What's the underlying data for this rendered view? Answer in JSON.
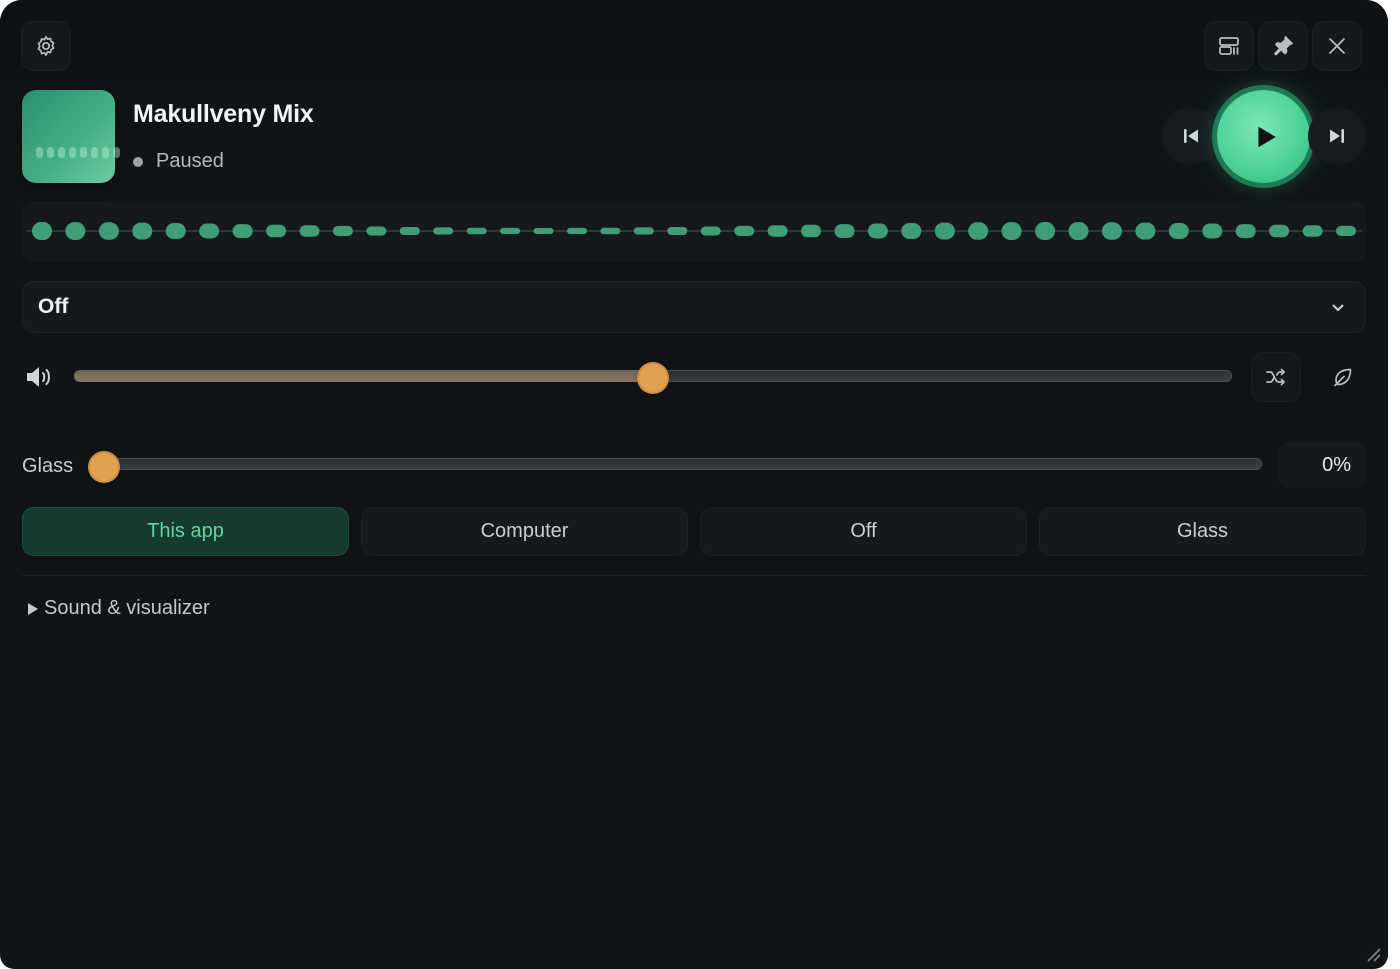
{
  "titlebar": {
    "icons": [
      "gear-icon",
      "layout-icon",
      "pin-icon",
      "close-icon"
    ]
  },
  "track": {
    "title": "Makullveny Mix",
    "status": "Paused"
  },
  "transport": {
    "icons": [
      "previous-icon",
      "play-icon",
      "next-icon"
    ]
  },
  "visualizer": {
    "bars": 40,
    "color": "#3f9e77"
  },
  "source_dropdown": {
    "value": "Off"
  },
  "volume": {
    "level": 0.5,
    "icons": [
      "volume-icon",
      "shuffle-icon",
      "leaf-icon"
    ]
  },
  "glass": {
    "label": "Glass",
    "value": 0,
    "percent_text": "0%"
  },
  "modes": {
    "options": [
      "This app",
      "Computer",
      "Off",
      "Glass"
    ],
    "active": "This app"
  },
  "section": {
    "label": "Sound & visualizer"
  },
  "colors": {
    "accent": "#4fd398",
    "slider_thumb": "#e0a052",
    "background": "#111416"
  }
}
